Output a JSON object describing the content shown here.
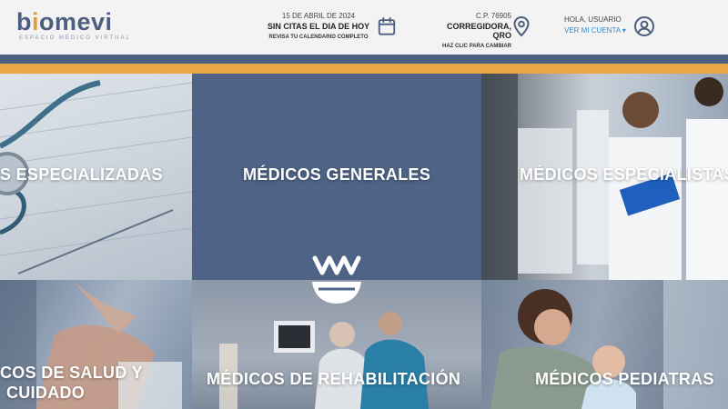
{
  "header": {
    "logo": {
      "text_a": "b",
      "text_accent": "i",
      "text_b": "omevi",
      "subtitle": "ESPACIO MÉDICO VIRTUAL"
    },
    "date": {
      "date": "15 DE ABRIL DE 2024",
      "status": "SIN CITAS EL DIA DE HOY",
      "link": "REVISA TU CALENDARIO COMPLETO",
      "icon": "calendar-icon"
    },
    "location": {
      "postal": "C.P. 76905",
      "city": "CORREGIDORA, QRO",
      "link": "HAZ CLIC PARA CAMBIAR",
      "icon": "map-pin-icon"
    },
    "user": {
      "greeting": "HOLA, USUARIO",
      "account": "VER MI CUENTA ▾",
      "icon": "user-icon"
    }
  },
  "colors": {
    "navy": "#4b5e7e",
    "orange": "#e8a644",
    "tile_blue": "#4e6385"
  },
  "tiles": [
    {
      "label": "S ESPECIALIZADAS"
    },
    {
      "label": "MÉDICOS GENERALES"
    },
    {
      "label": "MÉDICOS ESPECIALISTAS"
    },
    {
      "label_1": "COS DE SALUD Y",
      "label_2": "CUIDADO"
    },
    {
      "label": "MÉDICOS DE REHABILITACIÓN"
    },
    {
      "label": "MÉDICOS PEDIATRAS"
    }
  ]
}
